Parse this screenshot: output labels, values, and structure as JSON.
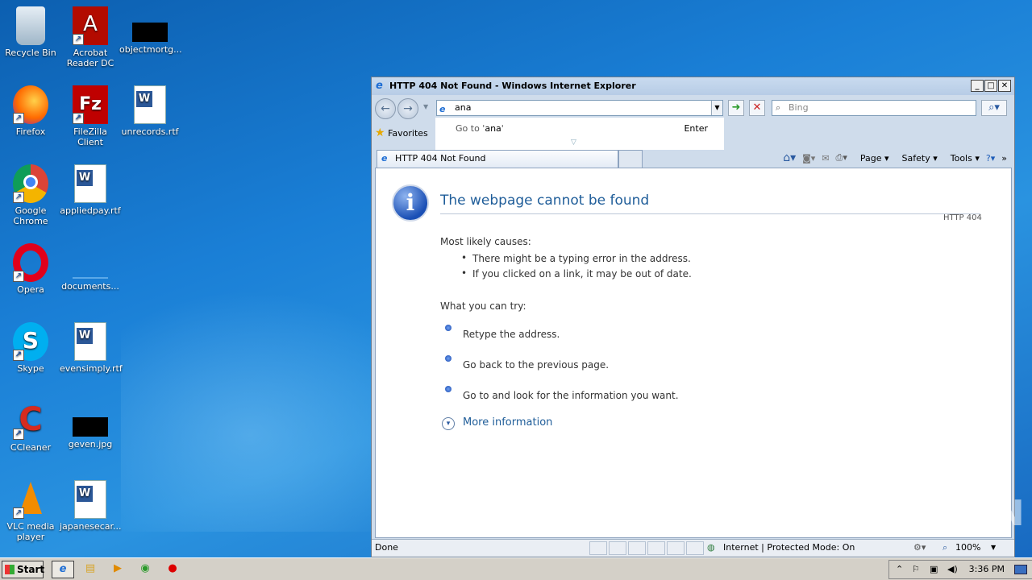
{
  "desktop": {
    "icons": [
      {
        "label": "Recycle Bin",
        "glyph": "🗑"
      },
      {
        "label": "Acrobat Reader DC",
        "glyph": "A"
      },
      {
        "label": "objectmortg...",
        "glyph": ""
      },
      {
        "label": "Firefox",
        "glyph": "🦊"
      },
      {
        "label": "FileZilla Client",
        "glyph": "Fz"
      },
      {
        "label": "unrecords.rtf",
        "glyph": ""
      },
      {
        "label": "Google Chrome",
        "glyph": "◉"
      },
      {
        "label": "appliedpay.rtf",
        "glyph": ""
      },
      {
        "label": "Opera",
        "glyph": "O"
      },
      {
        "label": "documents...",
        "glyph": ""
      },
      {
        "label": "Skype",
        "glyph": "S"
      },
      {
        "label": "evensimply.rtf",
        "glyph": ""
      },
      {
        "label": "CCleaner",
        "glyph": "C"
      },
      {
        "label": "geven.jpg",
        "glyph": ""
      },
      {
        "label": "VLC media player",
        "glyph": "▲"
      },
      {
        "label": "japanesecar..."
      }
    ]
  },
  "browser": {
    "title": "HTTP 404 Not Found - Windows Internet Explorer",
    "address_value": "ana",
    "search_placeholder": "Bing",
    "autocomplete": {
      "go_prefix": "Go to '",
      "go_value": "ana",
      "go_suffix": "'",
      "enter": "Enter"
    },
    "favorites_label": "Favorites",
    "tab_title": "HTTP 404 Not Found",
    "command_bar": {
      "page": "Page",
      "safety": "Safety",
      "tools": "Tools"
    },
    "content": {
      "heading": "The webpage cannot be found",
      "code": "HTTP 404",
      "causes_title": "Most likely causes:",
      "causes": [
        "There might be a typing error in the address.",
        "If you clicked on a link, it may be out of date."
      ],
      "try_title": "What you can try:",
      "tries": [
        "Retype the address.",
        "Go back to the previous page.",
        "Go to  and look for the information you want."
      ],
      "more_info": "More information"
    },
    "status": {
      "left": "Done",
      "zone": "Internet | Protected Mode: On",
      "zoom": "100%"
    }
  },
  "watermark": "ANY.RUN",
  "taskbar": {
    "start": "Start",
    "time": "3:36 PM"
  }
}
